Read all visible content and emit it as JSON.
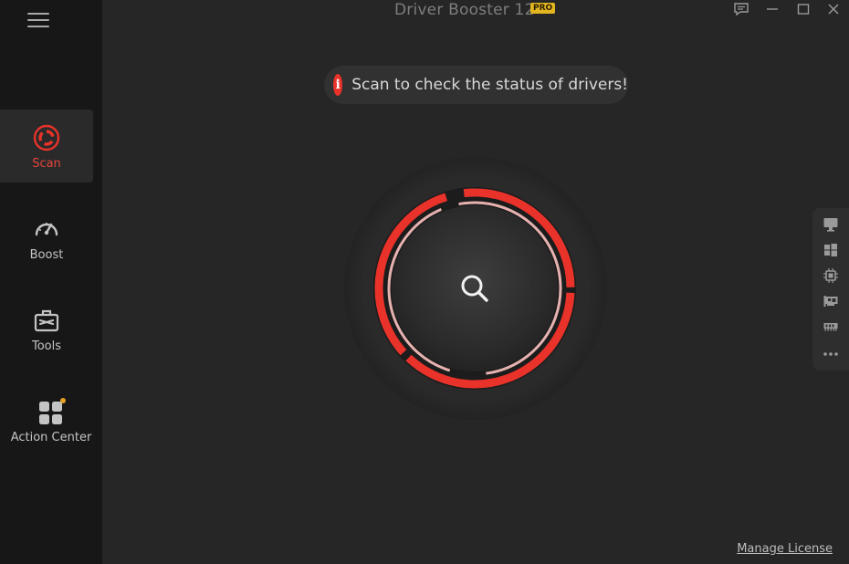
{
  "app": {
    "title": "Driver Booster 12",
    "badge": "PRO"
  },
  "sidebar": {
    "items": [
      {
        "label": "Scan",
        "icon": "scan-icon",
        "active": true
      },
      {
        "label": "Boost",
        "icon": "gauge-icon"
      },
      {
        "label": "Tools",
        "icon": "toolbox-icon"
      },
      {
        "label": "Action Center",
        "icon": "apps-grid-icon"
      }
    ]
  },
  "status": {
    "message": "Scan to check the status of drivers!",
    "icon_glyph": "i"
  },
  "scan_button": {
    "icon": "search-icon"
  },
  "right_rail": {
    "icons": [
      "monitor-icon",
      "windows-icon",
      "chip-icon",
      "network-card-icon",
      "memory-icon",
      "more-icon"
    ]
  },
  "footer": {
    "manage_license": "Manage License"
  },
  "colors": {
    "accent": "#e8322a",
    "badge": "#e2b420",
    "background": "#262626",
    "sidebar": "#171717"
  }
}
